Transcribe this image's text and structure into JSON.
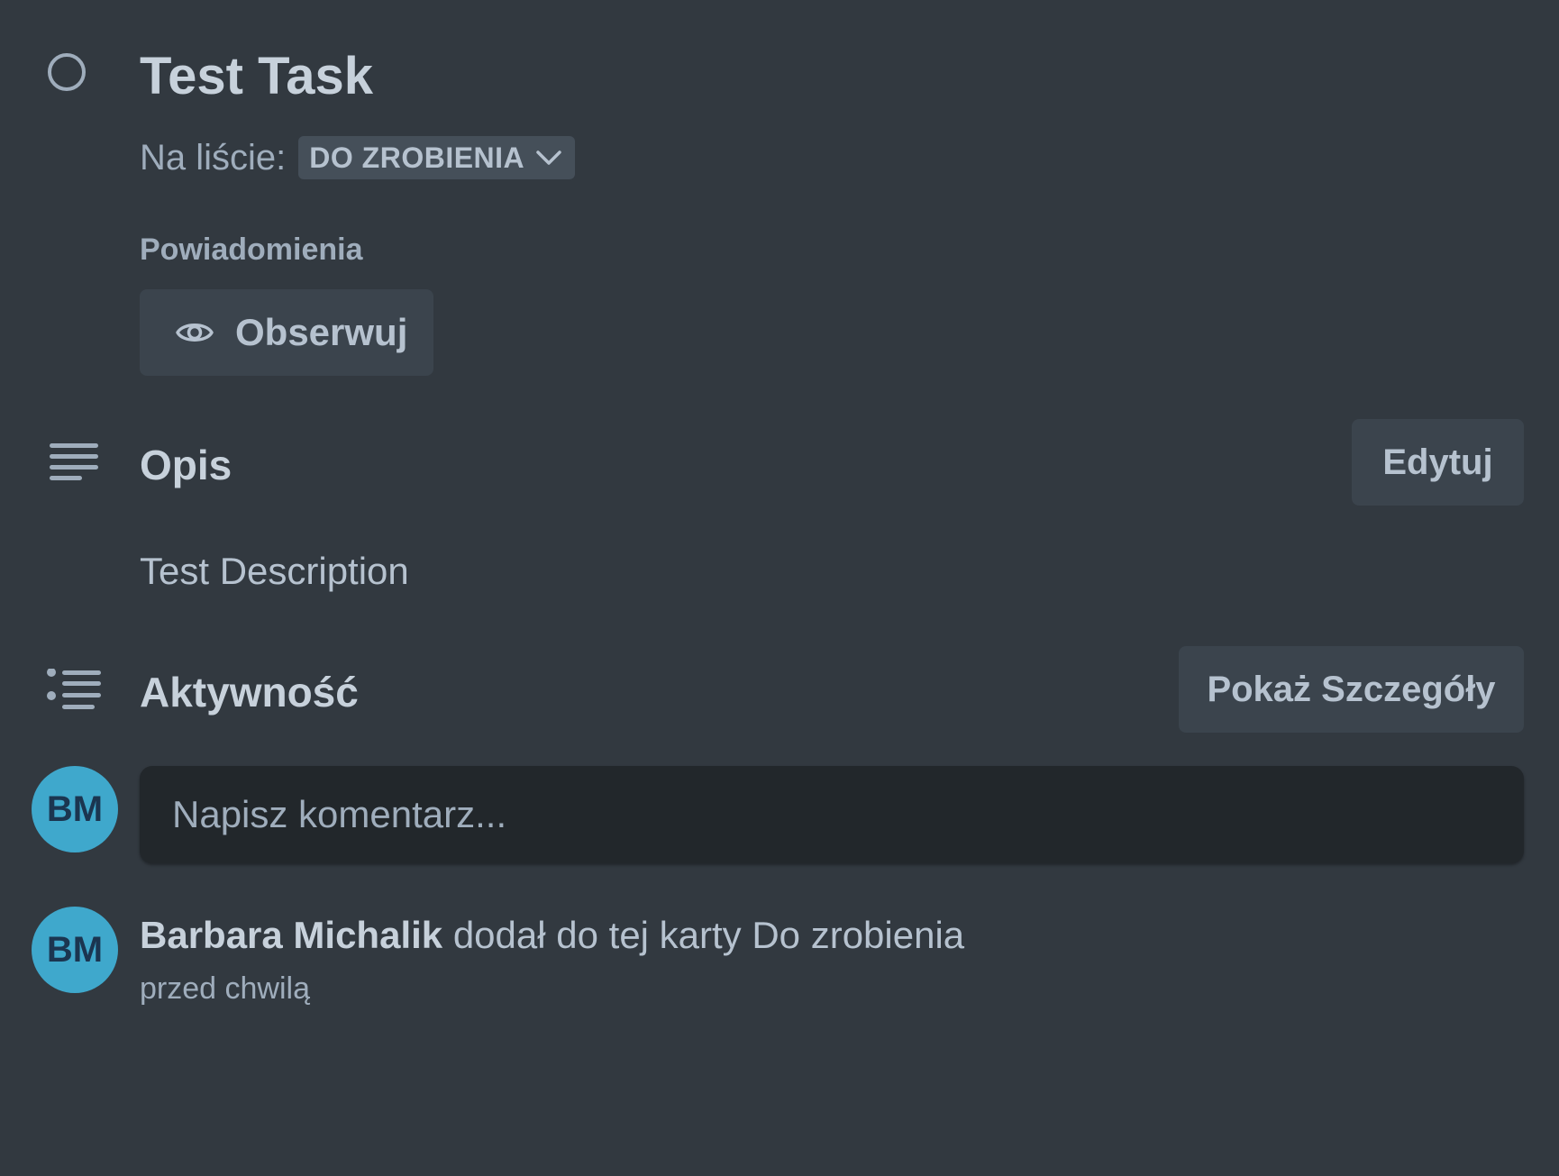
{
  "task": {
    "title": "Test Task",
    "list_label": "Na liście:",
    "list_value": "DO ZROBIENIA"
  },
  "notifications": {
    "label": "Powiadomienia",
    "watch_label": "Obserwuj"
  },
  "description": {
    "title": "Opis",
    "edit_label": "Edytuj",
    "text": "Test Description"
  },
  "activity": {
    "title": "Aktywność",
    "details_label": "Pokaż Szczegóły",
    "comment_placeholder": "Napisz komentarz...",
    "current_user_initials": "BM",
    "entries": [
      {
        "initials": "BM",
        "user": "Barbara Michalik",
        "action": " dodał do tej karty Do zrobienia",
        "time": "przed chwilą"
      }
    ]
  },
  "icons": {
    "complete": "circle-outline-icon",
    "list_dropdown": "chevron-down-icon",
    "watch": "eye-icon",
    "description": "text-lines-icon",
    "activity": "bulleted-list-icon"
  },
  "colors": {
    "background": "#323940",
    "button": "#3b444d",
    "input": "#22272b",
    "avatar": "#3fa8cc",
    "text": "#b6c2cf"
  }
}
